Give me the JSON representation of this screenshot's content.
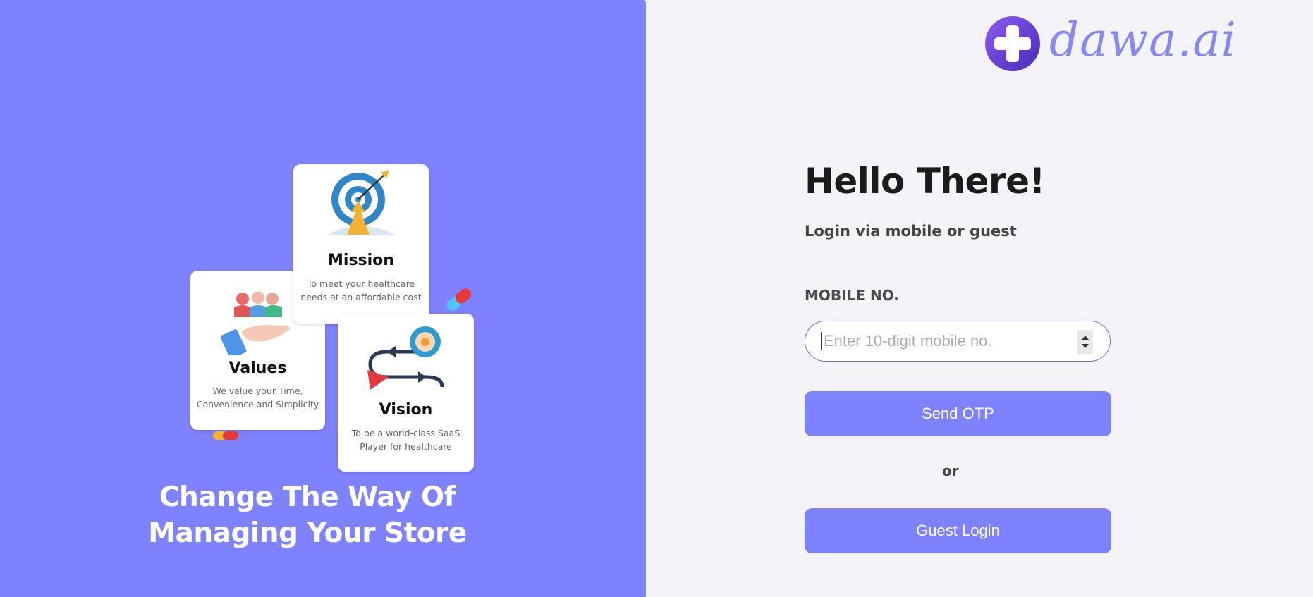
{
  "brand": {
    "logo_text": "dawa.ai",
    "accent": "#7f82fe",
    "logo_circle": "#6a3fd9"
  },
  "cards": {
    "mission": {
      "title": "Mission",
      "desc": "To meet your healthcare needs at an affordable cost"
    },
    "values": {
      "title": "Values",
      "desc": "We value your Time, Convenience and Simplicity"
    },
    "vision": {
      "title": "Vision",
      "desc": "To be a world-class SaaS Player for healthcare"
    }
  },
  "tagline": {
    "line1": "Change The Way Of",
    "line2": "Managing Your Store"
  },
  "login": {
    "title": "Hello There!",
    "subtitle": "Login via mobile or guest",
    "mobile_label": "MOBILE NO.",
    "mobile_placeholder": "Enter 10-digit mobile no.",
    "mobile_value": "",
    "send_otp": "Send OTP",
    "or": "or",
    "guest_login": "Guest Login"
  }
}
